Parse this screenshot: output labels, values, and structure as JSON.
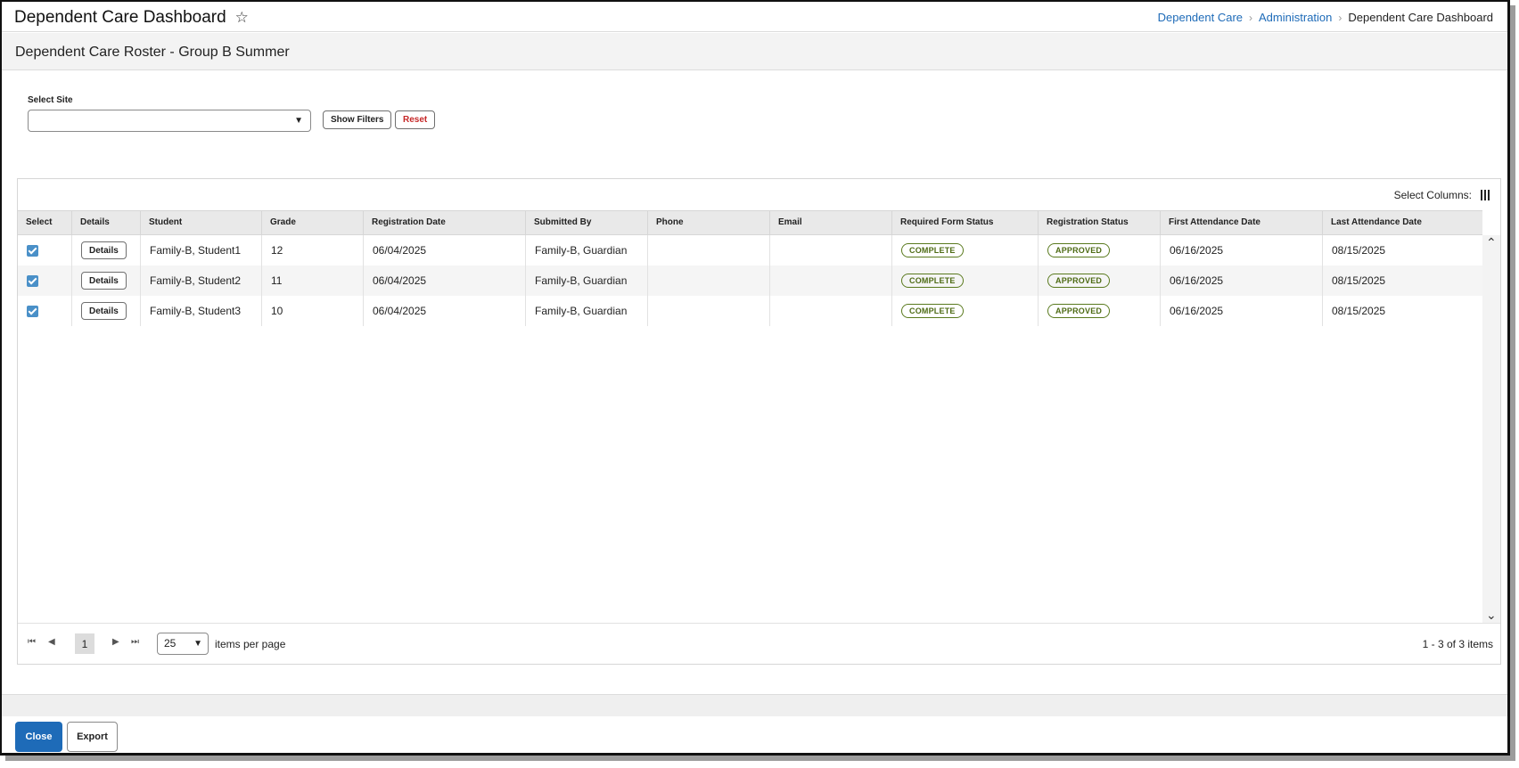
{
  "header": {
    "title": "Dependent Care Dashboard",
    "breadcrumb": [
      "Dependent Care",
      "Administration",
      "Dependent Care Dashboard"
    ]
  },
  "subheader": {
    "title": "Dependent Care Roster - Group B Summer"
  },
  "filters": {
    "site_label": "Select Site",
    "site_value": "",
    "show_filters": "Show Filters",
    "reset": "Reset"
  },
  "grid": {
    "select_columns": "Select Columns:",
    "columns": [
      "Select",
      "Details",
      "Student",
      "Grade",
      "Registration Date",
      "Submitted By",
      "Phone",
      "Email",
      "Required Form Status",
      "Registration Status",
      "First Attendance Date",
      "Last Attendance Date"
    ],
    "details_label": "Details",
    "rows": [
      {
        "selected": true,
        "student": "Family-B, Student1",
        "grade": "12",
        "reg_date": "06/04/2025",
        "submitted_by": "Family-B, Guardian",
        "phone": "",
        "email": "",
        "form_status": "COMPLETE",
        "reg_status": "APPROVED",
        "first_date": "06/16/2025",
        "last_date": "08/15/2025"
      },
      {
        "selected": true,
        "student": "Family-B, Student2",
        "grade": "11",
        "reg_date": "06/04/2025",
        "submitted_by": "Family-B, Guardian",
        "phone": "",
        "email": "",
        "form_status": "COMPLETE",
        "reg_status": "APPROVED",
        "first_date": "06/16/2025",
        "last_date": "08/15/2025"
      },
      {
        "selected": true,
        "student": "Family-B, Student3",
        "grade": "10",
        "reg_date": "06/04/2025",
        "submitted_by": "Family-B, Guardian",
        "phone": "",
        "email": "",
        "form_status": "COMPLETE",
        "reg_status": "APPROVED",
        "first_date": "06/16/2025",
        "last_date": "08/15/2025"
      }
    ],
    "pager": {
      "current_page": "1",
      "per_page": "25",
      "per_page_label": "items per page",
      "summary": "1 - 3 of 3 items"
    }
  },
  "footer": {
    "close": "Close",
    "export": "Export"
  },
  "colors": {
    "accent": "#1e6bb8",
    "status_green": "#4e6b15",
    "reset_red": "#c62828"
  }
}
